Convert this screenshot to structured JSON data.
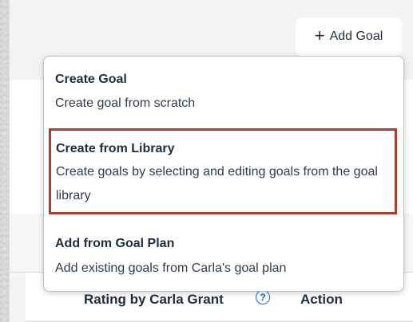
{
  "toolbar": {
    "add_goal_label": "Add Goal",
    "add_goal_icon": "plus-icon"
  },
  "menu": {
    "items": [
      {
        "title": "Create Goal",
        "description": "Create goal from scratch"
      },
      {
        "title": "Create from Library",
        "description": "Create goals by selecting and editing goals from the goal library"
      },
      {
        "title": "Add from Goal Plan",
        "description": "Add existing goals from Carla's goal plan"
      }
    ]
  },
  "table": {
    "columns": [
      {
        "label": "Rating by Carla Grant"
      },
      {
        "label": "Action"
      }
    ],
    "help_icon": "help-icon"
  },
  "colors": {
    "highlight_border": "#b23a2a",
    "help_icon": "#0a6ed1"
  }
}
